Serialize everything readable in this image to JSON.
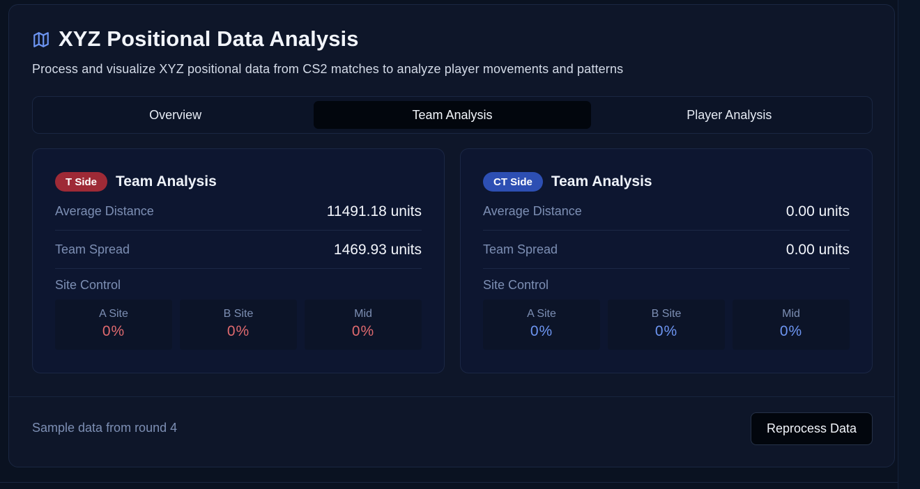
{
  "header": {
    "title": "XYZ Positional Data Analysis",
    "subtitle": "Process and visualize XYZ positional data from CS2 matches to analyze player movements and patterns",
    "icon": "map-icon"
  },
  "tabs": [
    {
      "label": "Overview",
      "active": false
    },
    {
      "label": "Team Analysis",
      "active": true
    },
    {
      "label": "Player Analysis",
      "active": false
    }
  ],
  "panels": {
    "t": {
      "badge": "T Side",
      "title": "Team Analysis",
      "avg_distance_label": "Average Distance",
      "avg_distance_value": "11491.18 units",
      "spread_label": "Team Spread",
      "spread_value": "1469.93 units",
      "site_control_label": "Site Control",
      "sites": [
        {
          "name": "A Site",
          "value": "0%"
        },
        {
          "name": "B Site",
          "value": "0%"
        },
        {
          "name": "Mid",
          "value": "0%"
        }
      ]
    },
    "ct": {
      "badge": "CT Side",
      "title": "Team Analysis",
      "avg_distance_label": "Average Distance",
      "avg_distance_value": "0.00 units",
      "spread_label": "Team Spread",
      "spread_value": "0.00 units",
      "site_control_label": "Site Control",
      "sites": [
        {
          "name": "A Site",
          "value": "0%"
        },
        {
          "name": "B Site",
          "value": "0%"
        },
        {
          "name": "Mid",
          "value": "0%"
        }
      ]
    }
  },
  "footer": {
    "note": "Sample data from round 4",
    "reprocess_label": "Reprocess Data"
  },
  "colors": {
    "t_badge": "#9e2a36",
    "ct_badge": "#2d4fb3",
    "t_value": "#e06a6f",
    "ct_value": "#6d95f2",
    "map_icon": "#6d95f2"
  }
}
